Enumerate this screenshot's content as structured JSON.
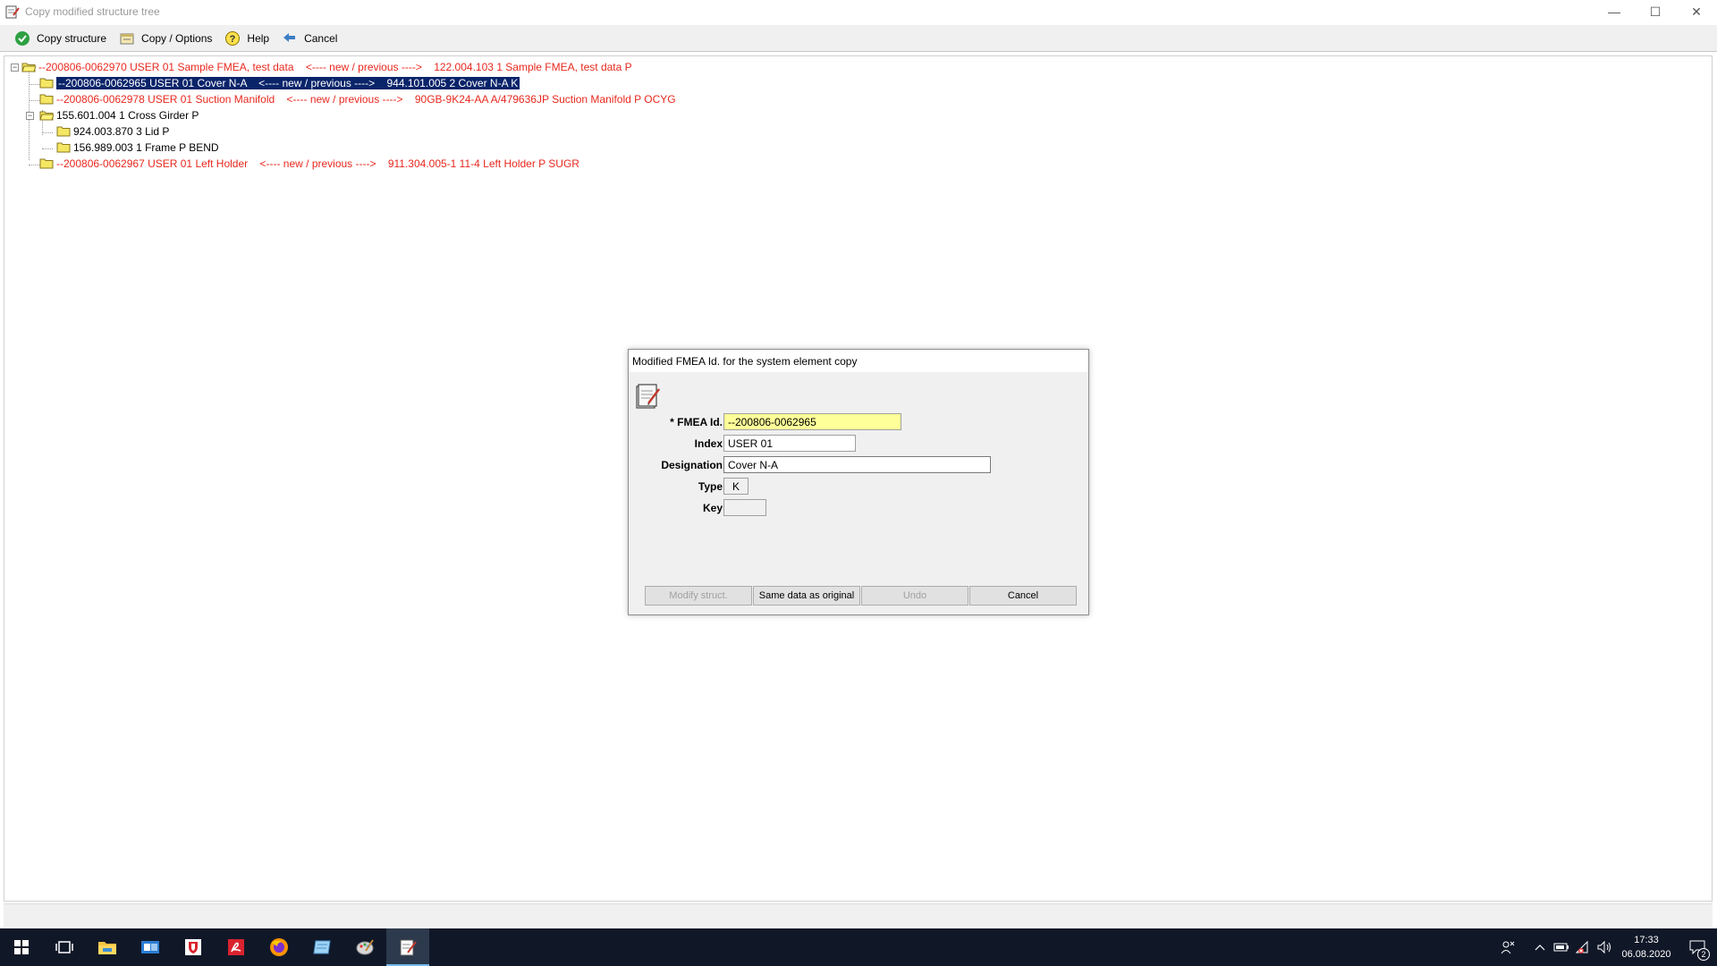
{
  "window": {
    "title": "Copy modified structure tree",
    "controls": [
      "minimize",
      "maximize",
      "close"
    ]
  },
  "toolbar": {
    "copy_structure": "Copy structure",
    "copy_options": "Copy / Options",
    "help": "Help",
    "cancel": "Cancel"
  },
  "tree": {
    "rows": [
      {
        "text": "--200806-0062970 USER 01 Sample FMEA, test data    <---- new / previous ---->    122.004.103 1 Sample FMEA, test data P",
        "style": "red",
        "level": 0,
        "expanded": true
      },
      {
        "text": "--200806-0062965 USER 01 Cover N-A    <---- new / previous ---->    944.101.005 2 Cover N-A K",
        "style": "selected",
        "level": 1
      },
      {
        "text": "--200806-0062978 USER 01 Suction Manifold    <---- new / previous ---->    90GB-9K24-AA A/479636JP Suction Manifold P OCYG",
        "style": "red",
        "level": 1
      },
      {
        "text": "155.601.004 1 Cross Girder P",
        "style": "normal",
        "level": 1,
        "expanded": true
      },
      {
        "text": "924.003.870 3 Lid P",
        "style": "normal",
        "level": 2
      },
      {
        "text": "156.989.003 1 Frame P BEND",
        "style": "normal",
        "level": 2
      },
      {
        "text": "--200806-0062967 USER 01 Left Holder    <---- new / previous ---->    911.304.005-1 11-4 Left Holder P SUGR",
        "style": "red",
        "level": 1
      }
    ]
  },
  "dialog": {
    "title": "Modified FMEA Id. for the system element copy",
    "fmea_label": "* FMEA Id.",
    "fmea_value": "--200806-0062965",
    "index_label": "Index",
    "index_value": "USER 01",
    "designation_label": "Designation",
    "designation_value": "Cover N-A",
    "type_label": "Type",
    "type_value": "K",
    "key_label": "Key",
    "key_value": "",
    "buttons": {
      "modify": "Modify struct.",
      "same": "Same data as original",
      "undo": "Undo",
      "cancel": "Cancel"
    }
  },
  "taskbar": {
    "apps": [
      "start",
      "task-view",
      "file-explorer",
      "outlook",
      "antivirus",
      "acrobat",
      "firefox",
      "notepad-app",
      "paint-app",
      "fmea-app"
    ],
    "clock_time": "17:33",
    "clock_date": "06.08.2020",
    "notification_count": "2"
  },
  "colors": {
    "red_text": "#e8281e",
    "selection": "#0a246a",
    "required_field": "#ffff99",
    "taskbar": "#101828"
  }
}
